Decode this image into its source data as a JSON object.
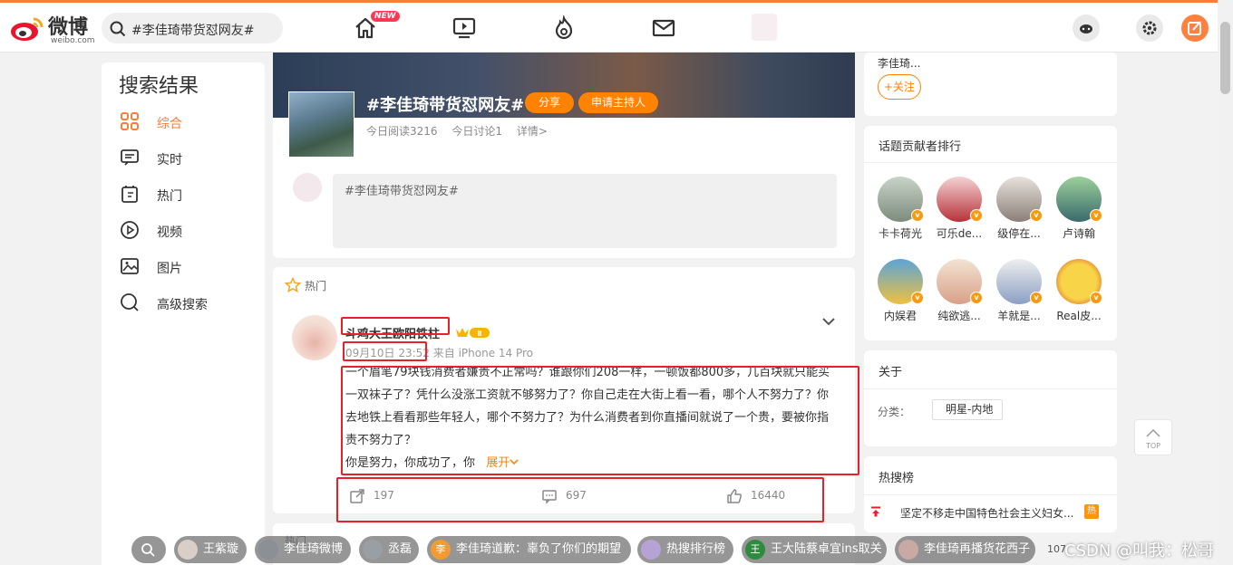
{
  "brand": {
    "name": "微博",
    "sub": "weibo.com"
  },
  "search": {
    "value": "#李佳琦带货怼网友#"
  },
  "nav": {
    "new_badge": "NEW"
  },
  "sidebar": {
    "title": "搜索结果",
    "items": [
      {
        "label": "综合",
        "icon": "grid-icon"
      },
      {
        "label": "实时",
        "icon": "realtime-icon"
      },
      {
        "label": "热门",
        "icon": "hot-icon"
      },
      {
        "label": "视频",
        "icon": "video-icon"
      },
      {
        "label": "图片",
        "icon": "image-icon"
      },
      {
        "label": "高级搜索",
        "icon": "search-icon"
      }
    ]
  },
  "topic": {
    "title": "#李佳琦带货怼网友#",
    "share_label": "分享",
    "host_label": "申请主持人",
    "reads": "今日阅读3216",
    "discuss": "今日讨论1",
    "details": "详情>"
  },
  "composer": {
    "text": "#李佳琦带货怼网友#"
  },
  "feed": {
    "section_label": "热门",
    "post": {
      "author": "斗鸡大王欧阳铁柱",
      "time": "09月10日 23:52",
      "source": "来自 iPhone 14 Pro",
      "text": "一个眉笔79块钱消费者嫌贵不正常吗？谁跟你们208一样，一顿饭都800多，几百块就只能买一双袜子了？凭什么没涨工资就不够努力了？你自己走在大街上看一看，哪个人不努力了？你去地铁上看看那些年轻人，哪个不努力了？为什么消费者到你直播间就说了一个贵，要被你指责不努力了？",
      "text2": "你是努力，你成功了，你",
      "expand": "展开",
      "reposts": "197",
      "comments": "697",
      "likes": "16440"
    },
    "next_section_label": "热门"
  },
  "right": {
    "prev_name": "李佳琦...",
    "follow_label": "+关注",
    "contributors_title": "话题贡献者排行",
    "contributors": [
      {
        "name": "卡卡荷光"
      },
      {
        "name": "可乐de..."
      },
      {
        "name": "级停在..."
      },
      {
        "name": "卢诗翰"
      },
      {
        "name": "内娱君"
      },
      {
        "name": "纯欲逃..."
      },
      {
        "name": "羊就是..."
      },
      {
        "name": "Real皮..."
      }
    ],
    "about_title": "关于",
    "category_label": "分类：",
    "category_value": "明星-内地",
    "hotsearch_title": "热搜榜",
    "hotsearch_item": "坚定不移走中国特色社会主义妇女...",
    "hotsearch_badge": "热"
  },
  "totop_label": "TOP",
  "taskbar": {
    "chips": [
      {
        "label": ""
      },
      {
        "label": "王紫璇"
      },
      {
        "label": "李佳琦微博"
      },
      {
        "label": "丞磊"
      },
      {
        "label": "李佳琦道歉：辜负了你们的期望"
      },
      {
        "label": "热搜排行榜"
      },
      {
        "label": "王大陆蔡卓宜ins取关"
      },
      {
        "label": "李佳琦再播货花西子"
      }
    ],
    "count": "107"
  },
  "watermark": "CSDN @叫我：松哥",
  "colors": {
    "accent": "#fa7d3c",
    "orange": "#ff8200",
    "highlight": "#e8202a"
  }
}
